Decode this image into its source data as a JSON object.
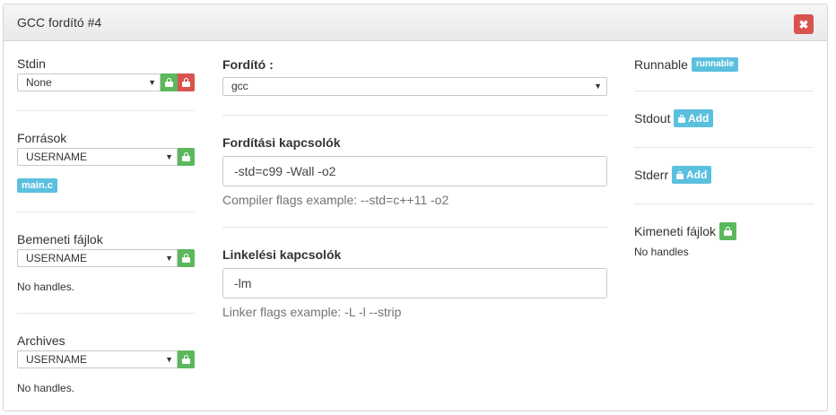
{
  "panel": {
    "title": "GCC fordító #4",
    "close_icon": "times-icon"
  },
  "left": {
    "stdin": {
      "label": "Stdin",
      "selected": "None"
    },
    "sources": {
      "label": "Források",
      "selected": "USERNAME",
      "file_badge": "main.c"
    },
    "input_files": {
      "label": "Bemeneti fájlok",
      "selected": "USERNAME",
      "empty_text": "No handles."
    },
    "archives": {
      "label": "Archives",
      "selected": "USERNAME",
      "empty_text": "No handles."
    }
  },
  "middle": {
    "compiler": {
      "label": "Fordító :",
      "selected": "gcc"
    },
    "compile_flags": {
      "label": "Fordítási kapcsolók",
      "value": "-std=c99 -Wall -o2",
      "help": "Compiler flags example: --std=c++11 -o2"
    },
    "link_flags": {
      "label": "Linkelési kapcsolók",
      "value": "-lm",
      "help": "Linker flags example: -L -l --strip"
    }
  },
  "right": {
    "runnable": {
      "label": "Runnable",
      "badge": "runnable"
    },
    "stdout": {
      "label": "Stdout",
      "add_label": "Add"
    },
    "stderr": {
      "label": "Stderr",
      "add_label": "Add"
    },
    "output_files": {
      "label": "Kimeneti fájlok",
      "empty_text": "No handles"
    }
  },
  "colors": {
    "success": "#5cb85c",
    "danger": "#d9534f",
    "info": "#5bc0de"
  }
}
